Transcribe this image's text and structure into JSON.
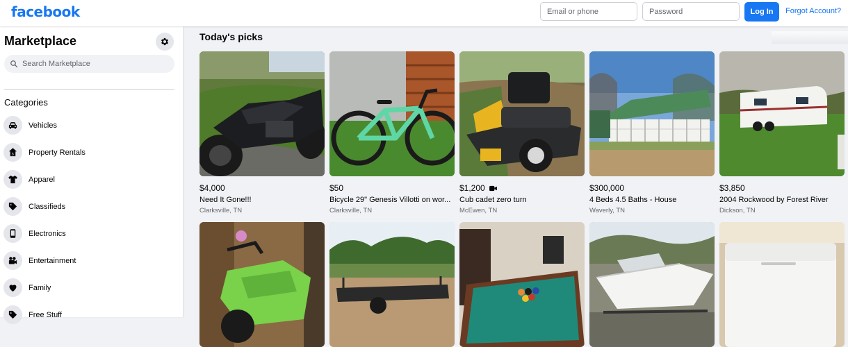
{
  "header": {
    "logo": "facebook",
    "email_placeholder": "Email or phone",
    "password_placeholder": "Password",
    "login_label": "Log In",
    "forgot_label": "Forgot Account?"
  },
  "sidebar": {
    "title": "Marketplace",
    "search_placeholder": "Search Marketplace",
    "categories_heading": "Categories",
    "categories": [
      {
        "label": "Vehicles",
        "icon": "car-icon"
      },
      {
        "label": "Property Rentals",
        "icon": "house-icon"
      },
      {
        "label": "Apparel",
        "icon": "shirt-icon"
      },
      {
        "label": "Classifieds",
        "icon": "tag-icon"
      },
      {
        "label": "Electronics",
        "icon": "phone-icon"
      },
      {
        "label": "Entertainment",
        "icon": "film-camera-icon"
      },
      {
        "label": "Family",
        "icon": "heart-icon"
      },
      {
        "label": "Free Stuff",
        "icon": "tag-icon"
      }
    ]
  },
  "main": {
    "section_title": "Today's picks",
    "listings": [
      {
        "price": "$4,000",
        "title": "Need It Gone!!!",
        "location": "Clarksville, TN",
        "image": "black sport motorcycle on grass"
      },
      {
        "price": "$50",
        "title": "Bicycle 29\" Genesis Villotti on wor...",
        "location": "Clarksville, TN",
        "image": "mint green mountain bike"
      },
      {
        "price": "$1,200",
        "title": "Cub cadet zero turn",
        "location": "McEwen, TN",
        "image": "yellow and black zero turn mower",
        "has_video": true
      },
      {
        "price": "$300,000",
        "title": "4 Beds 4.5 Baths - House",
        "location": "Waverly, TN",
        "image": "white farmhouse with green roof"
      },
      {
        "price": "$3,850",
        "title": "2004 Rockwood by Forest River",
        "location": "Dickson, TN",
        "image": "white travel trailer in field"
      },
      {
        "price": "",
        "title": "",
        "location": "",
        "image": "green kids ATV"
      },
      {
        "price": "",
        "title": "",
        "location": "",
        "image": "utility trailer on dirt lot"
      },
      {
        "price": "",
        "title": "",
        "location": "",
        "image": "pool table with balls"
      },
      {
        "price": "",
        "title": "",
        "location": "",
        "image": "white boat on trailer"
      },
      {
        "price": "",
        "title": "",
        "location": "",
        "image": "white chest freezer"
      }
    ]
  },
  "colors": {
    "brand": "#1877f2",
    "page_bg": "#f0f2f5",
    "muted_text": "#65676b"
  }
}
